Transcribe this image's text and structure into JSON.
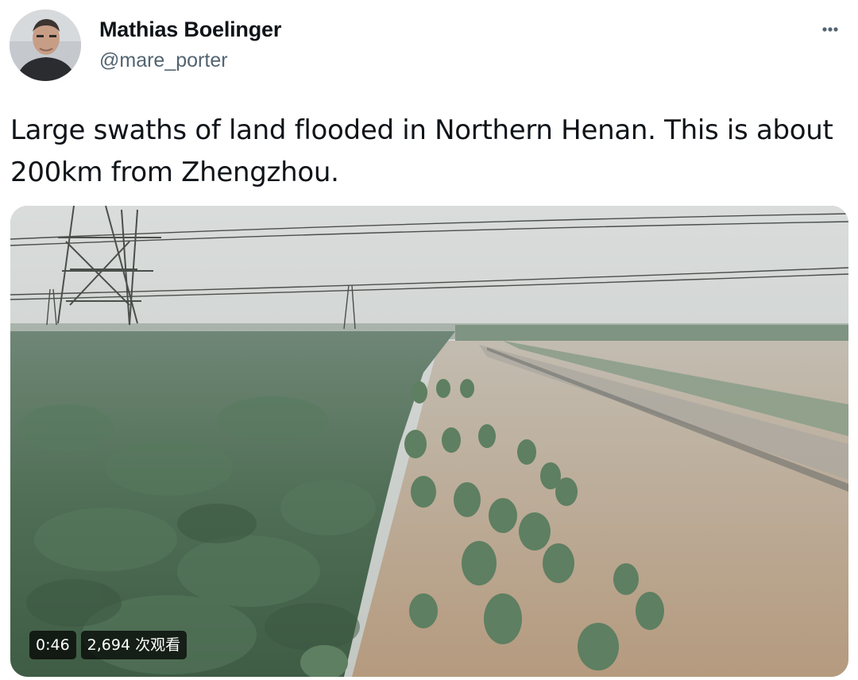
{
  "author": {
    "display_name": "Mathias Boelinger",
    "handle": "@mare_porter",
    "avatar_icon": "person-photo-avatar"
  },
  "more_icon": "more-horizontal-icon",
  "tweet": {
    "text": "Large swaths of land flooded in Northern Henan. This is about 200km from Zhengzhou."
  },
  "video": {
    "duration": "0:46",
    "views": "2,694 次观看"
  },
  "colors": {
    "text_primary": "#0f1419",
    "text_secondary": "#536471",
    "overlay_pill": "#000000b8"
  }
}
